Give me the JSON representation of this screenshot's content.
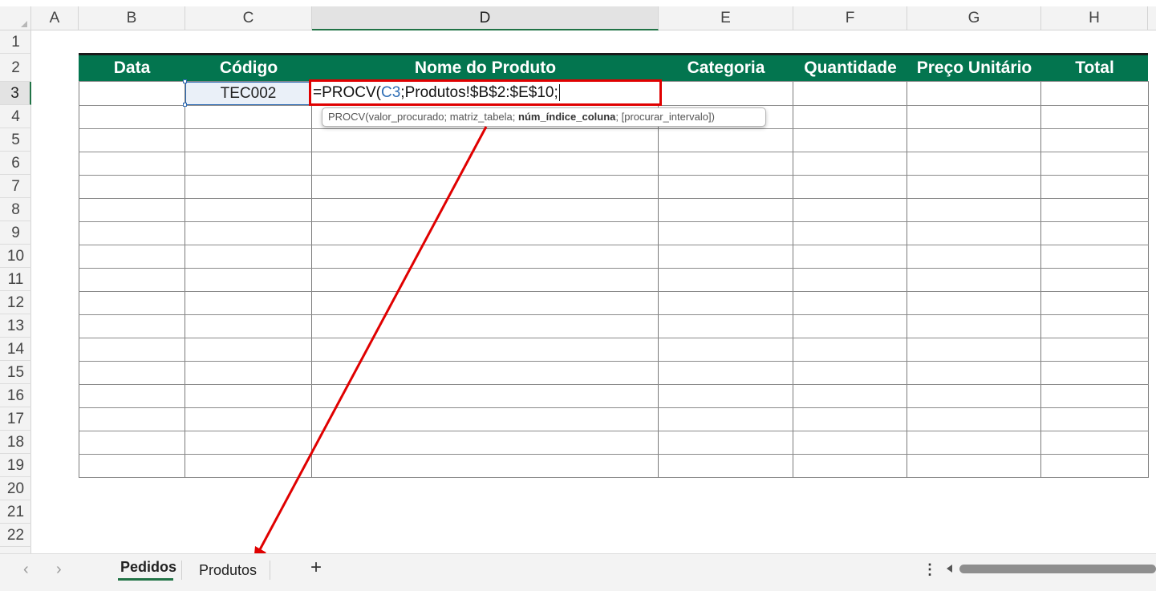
{
  "columns": [
    "A",
    "B",
    "C",
    "D",
    "E",
    "F",
    "G",
    "H"
  ],
  "rows": [
    "1",
    "2",
    "3",
    "4",
    "5",
    "6",
    "7",
    "8",
    "9",
    "10",
    "11",
    "12",
    "13",
    "14",
    "15",
    "16",
    "17",
    "18",
    "19",
    "20",
    "21",
    "22"
  ],
  "table_headers": [
    "Data",
    "Código",
    "Nome do Produto",
    "Categoria",
    "Quantidade",
    "Preço Unitário",
    "Total"
  ],
  "active_cell": {
    "value": "TEC002"
  },
  "formula": {
    "prefix": "=PROCV(",
    "ref": "C3",
    "rest": ";Produtos!$B$2:$E$10;"
  },
  "tooltip": {
    "fn": "PROCV(",
    "arg1": "valor_procurado; matriz_tabela; ",
    "arg_current": "núm_índice_coluna",
    "arg_rest": "; [procurar_intervalo])"
  },
  "sheets": {
    "tab1": "Pedidos",
    "tab2": "Produtos",
    "add": "+"
  },
  "icons": {
    "nav_prev": "chevron-left-icon",
    "nav_next": "chevron-right-icon",
    "more": "more-vertical-icon"
  },
  "colors": {
    "header_bg": "#03754f",
    "highlight": "#e00000",
    "accent": "#217346"
  }
}
